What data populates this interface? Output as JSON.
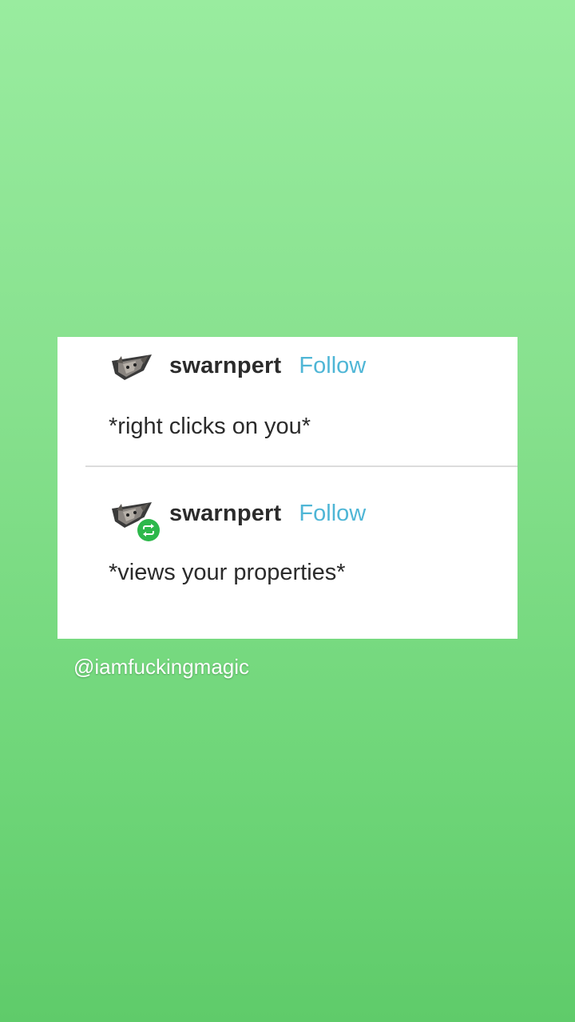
{
  "posts": [
    {
      "username": "swarnpert",
      "follow_label": "Follow",
      "text": "*right clicks on you*",
      "avatar_icon": "cat-avatar-icon",
      "reblogged": false
    },
    {
      "username": "swarnpert",
      "follow_label": "Follow",
      "text": "*views your properties*",
      "avatar_icon": "cat-avatar-icon",
      "reblogged": true,
      "badge_icon": "reblog-icon"
    }
  ],
  "caption": "@iamfuckingmagic",
  "colors": {
    "follow": "#4fb6d6",
    "reblog_badge": "#2db84b",
    "background_top": "#99ec9f",
    "background_bottom": "#5fcb6a"
  }
}
